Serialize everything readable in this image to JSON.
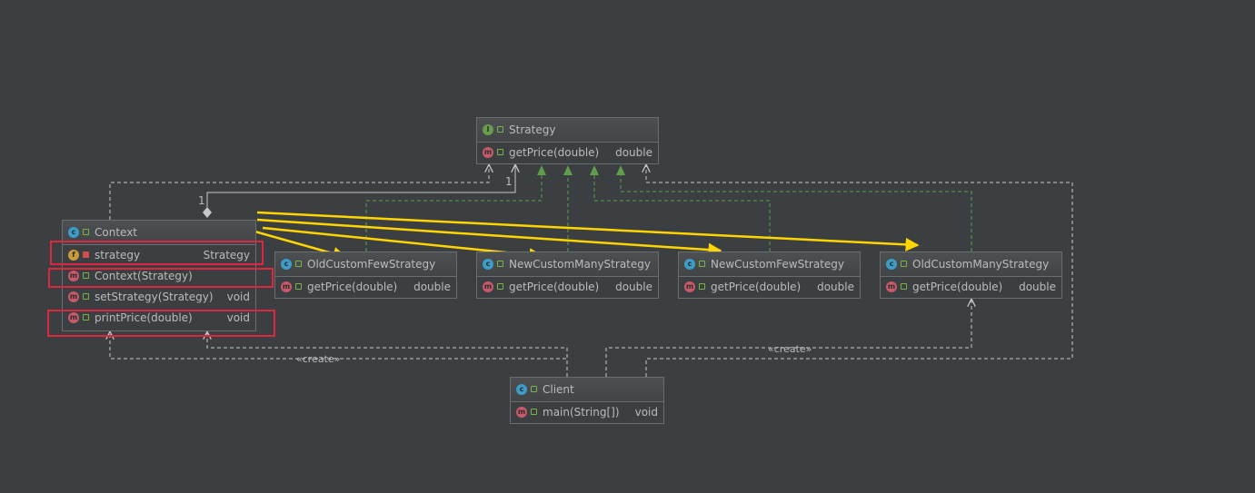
{
  "diagram": {
    "classes": {
      "strategy": {
        "badge": "I",
        "name": "Strategy",
        "methods": [
          {
            "badge": "m",
            "label": "getPrice(double)",
            "type": "double"
          }
        ]
      },
      "context": {
        "badge": "c",
        "name": "Context",
        "fields": [
          {
            "badge": "f",
            "label": "strategy",
            "type": "Strategy"
          }
        ],
        "methods": [
          {
            "badge": "m",
            "label": "Context(Strategy)",
            "type": ""
          },
          {
            "badge": "m",
            "label": "setStrategy(Strategy)",
            "type": "void"
          },
          {
            "badge": "m",
            "label": "printPrice(double)",
            "type": "void"
          }
        ]
      },
      "old_custom_few": {
        "badge": "c",
        "name": "OldCustomFewStrategy",
        "methods": [
          {
            "badge": "m",
            "label": "getPrice(double)",
            "type": "double"
          }
        ]
      },
      "new_custom_many": {
        "badge": "c",
        "name": "NewCustomManyStrategy",
        "methods": [
          {
            "badge": "m",
            "label": "getPrice(double)",
            "type": "double"
          }
        ]
      },
      "new_custom_few": {
        "badge": "c",
        "name": "NewCustomFewStrategy",
        "methods": [
          {
            "badge": "m",
            "label": "getPrice(double)",
            "type": "double"
          }
        ]
      },
      "old_custom_many": {
        "badge": "c",
        "name": "OldCustomManyStrategy",
        "methods": [
          {
            "badge": "m",
            "label": "getPrice(double)",
            "type": "double"
          }
        ]
      },
      "client": {
        "badge": "c",
        "name": "Client",
        "methods": [
          {
            "badge": "m",
            "label": "main(String[])",
            "type": "void"
          }
        ]
      }
    },
    "edge_labels": {
      "create_left": "«create»",
      "create_right": "«create»",
      "multiplicity_context": "1",
      "multiplicity_strategy": "1"
    },
    "colors": {
      "background": "#3c3f41",
      "realization_arrow": "#5e9e4a",
      "dependency_line": "#c8c8c8",
      "annotation_arrow": "#ffd500",
      "highlight_box": "#e0263f"
    }
  }
}
